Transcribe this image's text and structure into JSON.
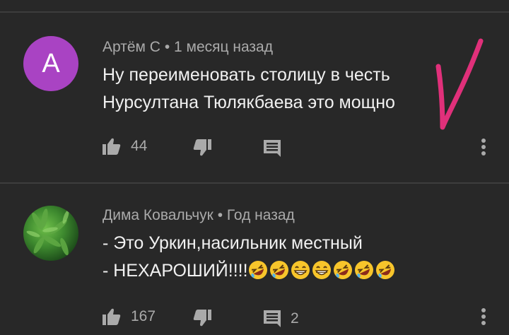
{
  "comments": [
    {
      "author": "Артём С",
      "age": "1 месяц назад",
      "avatar_letter": "А",
      "avatar_color": "#a943c3",
      "lines": [
        "Ну переименовать столицу в честь",
        "Нурсултана Тюлякбаева это мощно"
      ],
      "likes": "44",
      "replies": "",
      "annotation_color": "#e0307a"
    },
    {
      "author": "Дима Ковальчук",
      "age": "Год назад",
      "lines": [
        "- Это Уркин,насильник местный",
        "- НЕХАРОШИЙ!!!!"
      ],
      "emojis": [
        "rofl-emoji",
        "rofl-emoji",
        "grin-emoji",
        "grin-emoji",
        "rofl-emoji",
        "rofl-emoji",
        "rofl-emoji"
      ],
      "likes": "167",
      "replies": "2"
    }
  ],
  "meta_separator": "•"
}
